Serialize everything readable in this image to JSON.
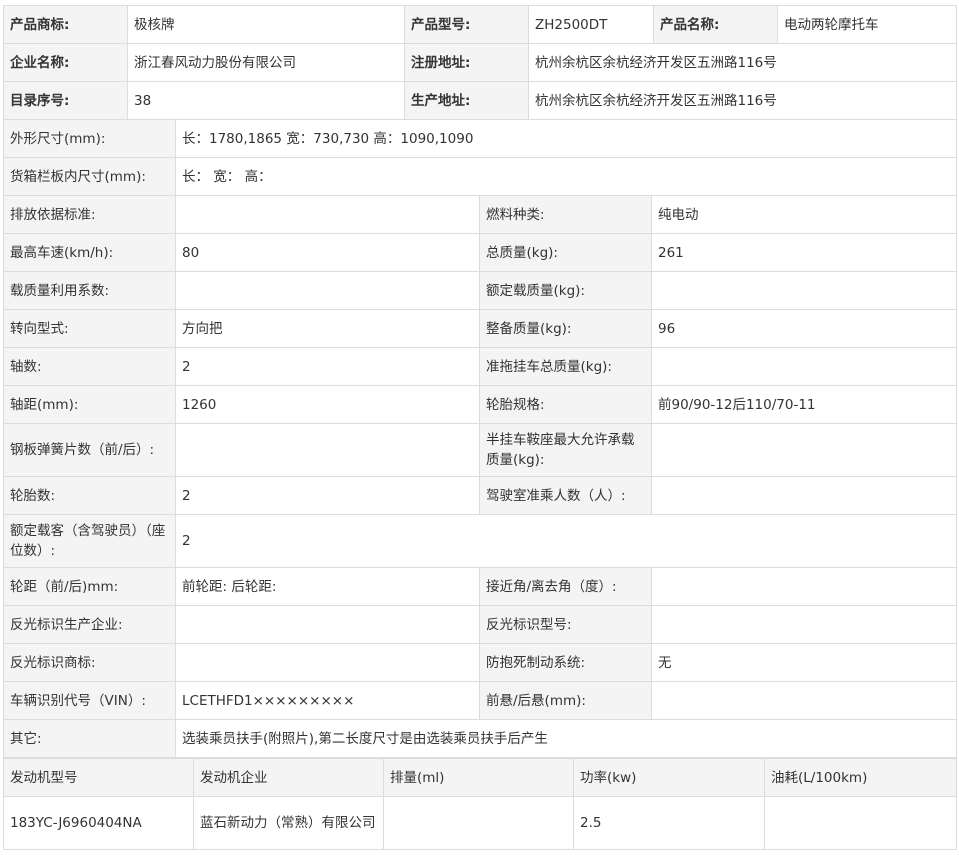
{
  "basic": {
    "brand_label": "产品商标:",
    "brand": "极核牌",
    "model_label": "产品型号:",
    "model": "ZH2500DT",
    "name_label": "产品名称:",
    "name": "电动两轮摩托车",
    "company_label": "企业名称:",
    "company": "浙江春风动力股份有限公司",
    "reg_addr_label": "注册地址:",
    "reg_addr": "杭州余杭区余杭经济开发区五洲路116号",
    "catalog_label": "目录序号:",
    "catalog": "38",
    "prod_addr_label": "生产地址:",
    "prod_addr": "杭州余杭区余杭经济开发区五洲路116号"
  },
  "spec": {
    "dimensions_label": "外形尺寸(mm):",
    "dimensions": "长：1780,1865 宽：730,730 高：1090,1090",
    "cargo_label": "货箱栏板内尺寸(mm):",
    "cargo": "长： 宽： 高：",
    "emission_label": "排放依据标准:",
    "emission": "",
    "fuel_label": "燃料种类:",
    "fuel": "纯电动",
    "max_speed_label": "最高车速(km/h):",
    "max_speed": "80",
    "total_mass_label": "总质量(kg):",
    "total_mass": "261",
    "load_coef_label": "载质量利用系数:",
    "load_coef": "",
    "rated_load_label": "额定载质量(kg):",
    "rated_load": "",
    "steering_label": "转向型式:",
    "steering": "方向把",
    "curb_mass_label": "整备质量(kg):",
    "curb_mass": "96",
    "axles_label": "轴数:",
    "axles": "2",
    "trailer_mass_label": "准拖挂车总质量(kg):",
    "trailer_mass": "",
    "wheelbase_label": "轴距(mm):",
    "wheelbase": "1260",
    "tire_spec_label": "轮胎规格:",
    "tire_spec": "前90/90-12后110/70-11",
    "springs_label": "钢板弹簧片数（前/后）:",
    "springs": "",
    "saddle_label": "半挂车鞍座最大允许承载质量(kg):",
    "saddle": "",
    "tires_label": "轮胎数:",
    "tires": "2",
    "cab_label": "驾驶室准乘人数（人）:",
    "cab": "",
    "passengers_label": "额定载客（含驾驶员）（座位数）:",
    "passengers": "2",
    "track_label": "轮距（前/后)mm:",
    "track": "前轮距: 后轮距:",
    "angle_label": "接近角/离去角（度）:",
    "angle": "",
    "reflect_maker_label": "反光标识生产企业:",
    "reflect_maker": "",
    "reflect_model_label": "反光标识型号:",
    "reflect_model": "",
    "reflect_brand_label": "反光标识商标:",
    "reflect_brand": "",
    "abs_label": "防抱死制动系统:",
    "abs": "无",
    "vin_label": "车辆识别代号（VIN）:",
    "vin": "LCETHFD1×××××××××",
    "overhang_label": "前悬/后悬(mm):",
    "overhang": "",
    "other_label": "其它:",
    "other": "选装乘员扶手(附照片),第二长度尺寸是由选装乘员扶手后产生"
  },
  "engine": {
    "headers": [
      "发动机型号",
      "发动机企业",
      "排量(ml)",
      "功率(kw)",
      "油耗(L/100km)"
    ],
    "row": [
      "183YC-J6960404NA",
      "蓝石新动力（常熟）有限公司",
      "",
      "2.5",
      ""
    ]
  }
}
